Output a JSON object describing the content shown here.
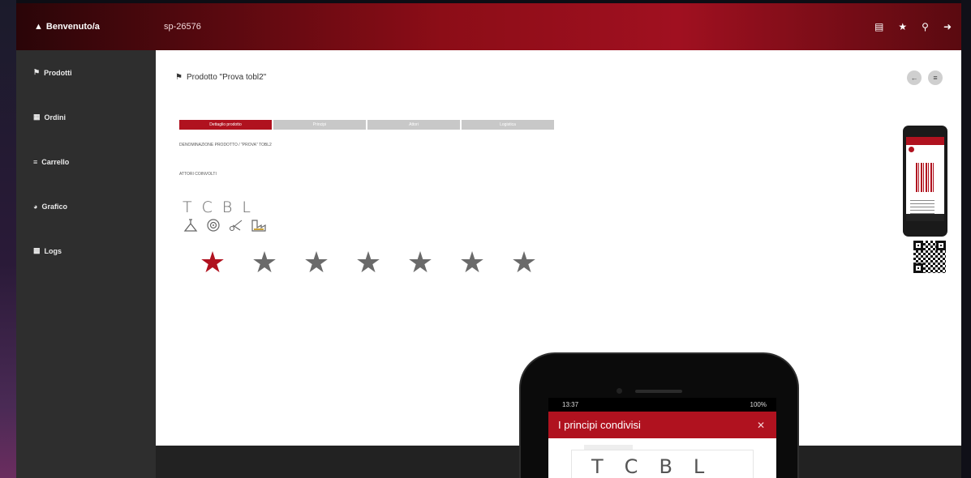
{
  "header": {
    "brand": "Benvenuto/a",
    "product_code": "sp-26576",
    "icons": [
      "document-icon",
      "star-icon",
      "key-icon",
      "logout-icon"
    ]
  },
  "sidebar": {
    "items": [
      {
        "icon": "tag-icon",
        "label": "Prodotti"
      },
      {
        "icon": "grid-icon",
        "label": "Ordini"
      },
      {
        "icon": "list-icon",
        "label": "Carrello"
      },
      {
        "icon": "globe-icon",
        "label": "Grafico"
      },
      {
        "icon": "chart-icon",
        "label": "Logs"
      }
    ]
  },
  "page": {
    "title": "Prodotto \"Prova tobl2\"",
    "tabs": [
      "Dettaglio prodotto",
      "Principi",
      "Attori",
      "Logistica"
    ],
    "section1_label": "DENOMINAZIONE PRODOTTO / \"PROVA\" TOBL2",
    "section1_value": "",
    "section2_label": "ATTORI COINVOLTI",
    "section2_value": "",
    "letters": [
      "T",
      "C",
      "B",
      "L"
    ],
    "pictograms": [
      "flask-icon",
      "target-icon",
      "scissors-icon",
      "factory-icon"
    ],
    "stars": [
      {
        "label": "",
        "active": true
      },
      {
        "label": "",
        "active": false
      },
      {
        "label": "",
        "active": false
      },
      {
        "label": "",
        "active": false
      },
      {
        "label": "",
        "active": false
      },
      {
        "label": "",
        "active": false
      },
      {
        "label": "",
        "active": false
      }
    ],
    "description": ""
  },
  "footer": {
    "left": "",
    "right": ""
  },
  "phone": {
    "time": "13:37",
    "battery": "100%",
    "modal_title": "I principi condivisi",
    "letters": [
      "T",
      "C",
      "B",
      "L"
    ]
  },
  "colors": {
    "accent": "#b0121f",
    "sidebar": "#2e2e2e",
    "star_inactive": "#6a6a6a"
  }
}
